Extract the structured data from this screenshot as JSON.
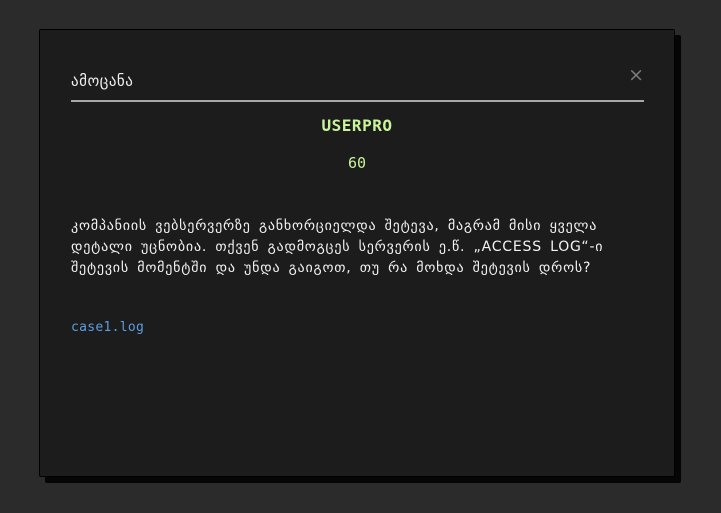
{
  "modal": {
    "title": "ამოცანა",
    "close_glyph": "×",
    "author": "USERPRO",
    "points": "60",
    "description": "კომპანიის  ვებსერვერზე განხორციელდა შეტევა, მაგრამ მისი ყველა დეტალი უცნობია. თქვენ გადმოგცეს სერვერის ე.წ. „access log“-ი შეტევის მომენტში და უნდა გაიგოთ, თუ რა მოხდა შეტევის დროს?",
    "file_link": "case1.log"
  }
}
